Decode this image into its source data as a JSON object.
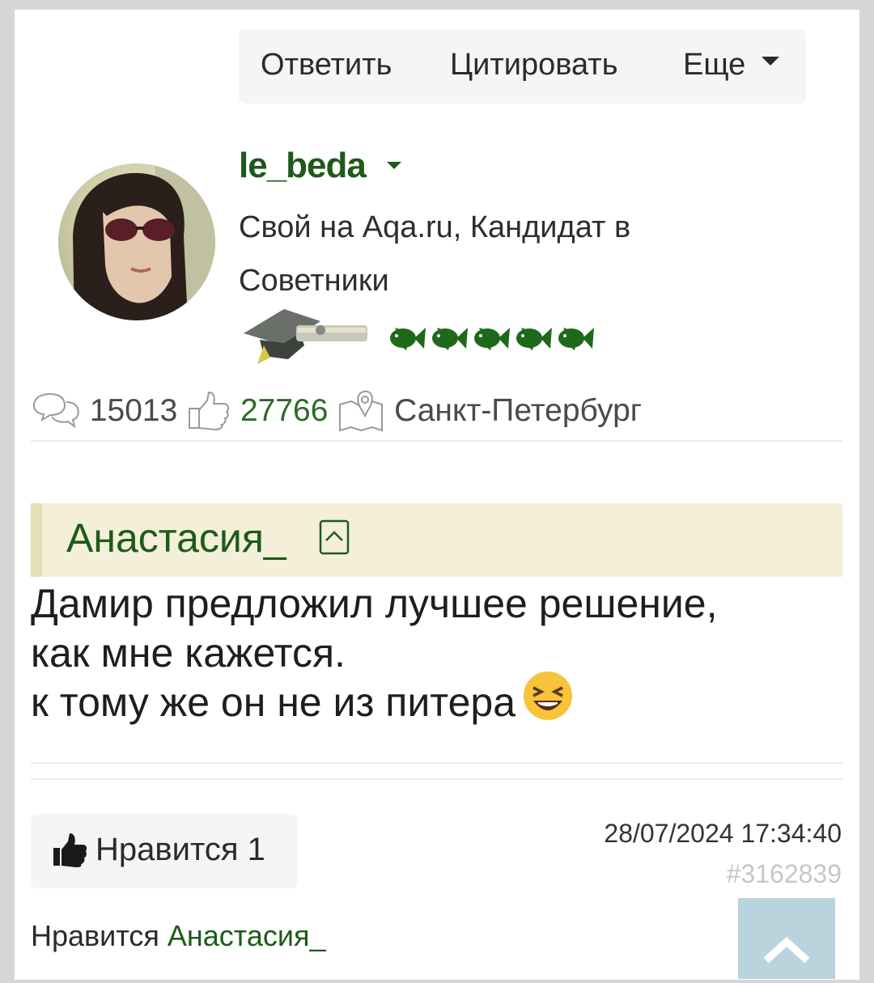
{
  "toolbar": {
    "reply": "Ответить",
    "quote": "Цитировать",
    "more": "Еще"
  },
  "author": {
    "username": "le_beda",
    "rank": "Свой на Aqa.ru, Кандидат в Советники",
    "fish_rating": 5
  },
  "stats": {
    "posts": "15013",
    "likes": "27766",
    "city": "Санкт-Петербург"
  },
  "post": {
    "quoted_author": "Анастасия_",
    "lines": [
      "Дамир предложил лучшее решение,",
      "как мне кажется.",
      "к тому же он не из питера"
    ]
  },
  "footer": {
    "like_button": "Нравится 1",
    "date": "28/07/2024 17:34:40",
    "post_id": "#3162839",
    "liked_prefix": "Нравится",
    "liked_by": "Анастасия_"
  },
  "colors": {
    "accent_green": "#1e5a1a",
    "quote_bg": "#f4efd9",
    "scroll_btn": "#b9d4dc"
  }
}
